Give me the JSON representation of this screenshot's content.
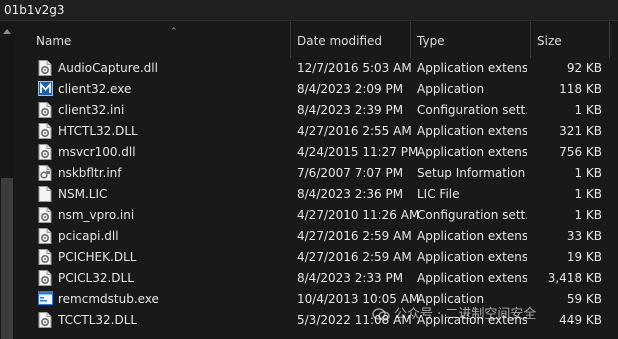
{
  "path": "01b1v2g3",
  "columns": {
    "name": "Name",
    "date": "Date modified",
    "type": "Type",
    "size": "Size"
  },
  "files": [
    {
      "name": "AudioCapture.dll",
      "date": "12/7/2016 5:03 AM",
      "type": "Application extens...",
      "size": "92 KB",
      "icon": "dll-gear-icon"
    },
    {
      "name": "client32.exe",
      "date": "8/4/2023 2:09 PM",
      "type": "Application",
      "size": "118 KB",
      "icon": "app-m-icon"
    },
    {
      "name": "client32.ini",
      "date": "8/4/2023 2:39 PM",
      "type": "Configuration sett...",
      "size": "1 KB",
      "icon": "ini-gear-icon"
    },
    {
      "name": "HTCTL32.DLL",
      "date": "4/27/2016 2:55 AM",
      "type": "Application extens...",
      "size": "321 KB",
      "icon": "dll-gear-icon"
    },
    {
      "name": "msvcr100.dll",
      "date": "4/24/2015 11:27 PM",
      "type": "Application extens...",
      "size": "756 KB",
      "icon": "dll-gear-icon"
    },
    {
      "name": "nskbfltr.inf",
      "date": "7/6/2007 7:07 PM",
      "type": "Setup Information",
      "size": "1 KB",
      "icon": "inf-icon"
    },
    {
      "name": "NSM.LIC",
      "date": "8/4/2023 2:36 PM",
      "type": "LIC File",
      "size": "1 KB",
      "icon": "blank-file-icon"
    },
    {
      "name": "nsm_vpro.ini",
      "date": "4/27/2010 11:26 AM",
      "type": "Configuration sett...",
      "size": "1 KB",
      "icon": "ini-gear-icon"
    },
    {
      "name": "pcicapi.dll",
      "date": "4/27/2016 2:59 AM",
      "type": "Application extens...",
      "size": "33 KB",
      "icon": "dll-gear-icon"
    },
    {
      "name": "PCICHEK.DLL",
      "date": "4/27/2016 2:59 AM",
      "type": "Application extens...",
      "size": "19 KB",
      "icon": "dll-gear-icon"
    },
    {
      "name": "PCICL32.DLL",
      "date": "8/4/2023 2:33 PM",
      "type": "Application extens...",
      "size": "3,418 KB",
      "icon": "dll-gear-icon"
    },
    {
      "name": "remcmdstub.exe",
      "date": "10/4/2013 10:05 AM",
      "type": "Application",
      "size": "59 KB",
      "icon": "app-window-icon"
    },
    {
      "name": "TCCTL32.DLL",
      "date": "5/3/2022 11:08 AM",
      "type": "Application extens...",
      "size": "449 KB",
      "icon": "dll-gear-icon"
    }
  ],
  "watermark": "公众号 · 二进制空间安全",
  "colors": {
    "background": "#191919",
    "text": "#e6e6e6",
    "header_divider": "#3a3a3a"
  }
}
